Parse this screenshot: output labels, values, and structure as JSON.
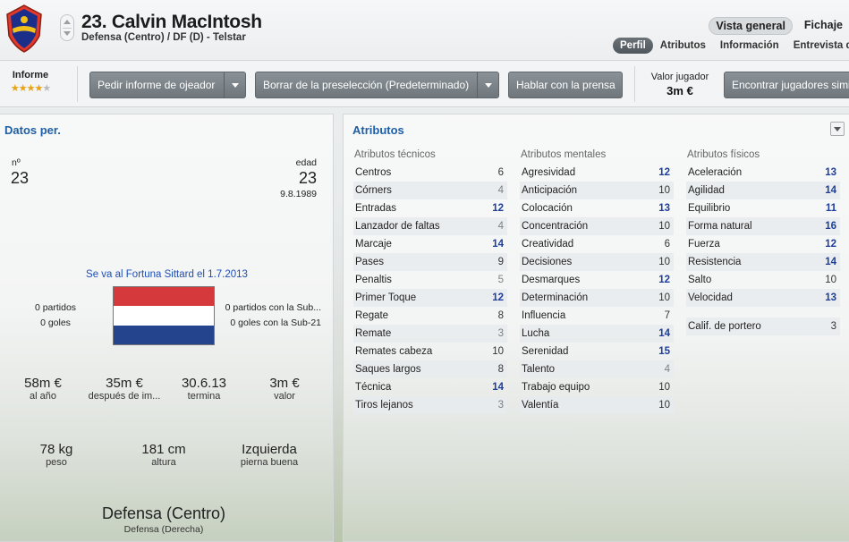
{
  "header": {
    "player_name": "23. Calvin MacIntosh",
    "player_subtitle": "Defensa (Centro) / DF (D) - Telstar",
    "top_tabs": [
      "Vista general",
      "Fichaje"
    ],
    "sub_tabs": [
      "Perfil",
      "Atributos",
      "Información",
      "Entrevista de"
    ]
  },
  "toolbar": {
    "report_label": "Informe",
    "report_stars": 4,
    "report_stars_max": 5,
    "btn_scout": "Pedir informe de ojeador",
    "btn_shortlist": "Borrar de la preselección (Predeterminado)",
    "btn_press": "Hablar con la prensa",
    "value_label": "Valor jugador",
    "value_amount": "3m €",
    "btn_find": "Encontrar jugadores similares"
  },
  "personal": {
    "title": "Datos per.",
    "number_label": "nº",
    "number": "23",
    "age_label": "edad",
    "age": "23",
    "birthdate": "9.8.1989",
    "transfer_note": "Se va al Fortuna Sittard el 1.7.2013",
    "matches": "0 partidos",
    "goals": "0 goles",
    "u21_matches": "0 partidos con la Sub...",
    "u21_goals": "0 goles con la Sub-21",
    "contract": [
      {
        "value": "58m €",
        "label": "al año"
      },
      {
        "value": "35m €",
        "label": "después de im..."
      },
      {
        "value": "30.6.13",
        "label": "termina"
      },
      {
        "value": "3m €",
        "label": "valor"
      }
    ],
    "physical": [
      {
        "value": "78 kg",
        "label": "peso"
      },
      {
        "value": "181 cm",
        "label": "altura"
      },
      {
        "value": "Izquierda",
        "label": "pierna buena"
      }
    ],
    "position_main": "Defensa (Centro)",
    "position_secondary": "Defensa (Derecha)"
  },
  "attributes": {
    "title": "Atributos",
    "technical": {
      "header": "Atributos técnicos",
      "items": [
        {
          "name": "Centros",
          "value": "6",
          "tone": "dark"
        },
        {
          "name": "Córners",
          "value": "4",
          "tone": "gray"
        },
        {
          "name": "Entradas",
          "value": "12",
          "tone": "blue"
        },
        {
          "name": "Lanzador de faltas",
          "value": "4",
          "tone": "gray"
        },
        {
          "name": "Marcaje",
          "value": "14",
          "tone": "blue"
        },
        {
          "name": "Pases",
          "value": "9",
          "tone": "dark"
        },
        {
          "name": "Penaltis",
          "value": "5",
          "tone": "gray"
        },
        {
          "name": "Primer Toque",
          "value": "12",
          "tone": "blue"
        },
        {
          "name": "Regate",
          "value": "8",
          "tone": "dark"
        },
        {
          "name": "Remate",
          "value": "3",
          "tone": "gray"
        },
        {
          "name": "Remates cabeza",
          "value": "10",
          "tone": "dark"
        },
        {
          "name": "Saques largos",
          "value": "8",
          "tone": "dark"
        },
        {
          "name": "Técnica",
          "value": "14",
          "tone": "blue"
        },
        {
          "name": "Tiros lejanos",
          "value": "3",
          "tone": "gray"
        }
      ]
    },
    "mental": {
      "header": "Atributos mentales",
      "items": [
        {
          "name": "Agresividad",
          "value": "12",
          "tone": "blue"
        },
        {
          "name": "Anticipación",
          "value": "10",
          "tone": "dark"
        },
        {
          "name": "Colocación",
          "value": "13",
          "tone": "blue"
        },
        {
          "name": "Concentración",
          "value": "10",
          "tone": "dark"
        },
        {
          "name": "Creatividad",
          "value": "6",
          "tone": "dark"
        },
        {
          "name": "Decisiones",
          "value": "10",
          "tone": "dark"
        },
        {
          "name": "Desmarques",
          "value": "12",
          "tone": "blue"
        },
        {
          "name": "Determinación",
          "value": "10",
          "tone": "dark"
        },
        {
          "name": "Influencia",
          "value": "7",
          "tone": "dark"
        },
        {
          "name": "Lucha",
          "value": "14",
          "tone": "blue"
        },
        {
          "name": "Serenidad",
          "value": "15",
          "tone": "blue"
        },
        {
          "name": "Talento",
          "value": "4",
          "tone": "gray"
        },
        {
          "name": "Trabajo equipo",
          "value": "10",
          "tone": "dark"
        },
        {
          "name": "Valentía",
          "value": "10",
          "tone": "dark"
        }
      ]
    },
    "physical": {
      "header": "Atributos físicos",
      "items": [
        {
          "name": "Aceleración",
          "value": "13",
          "tone": "blue"
        },
        {
          "name": "Agilidad",
          "value": "14",
          "tone": "blue"
        },
        {
          "name": "Equilibrio",
          "value": "11",
          "tone": "blue"
        },
        {
          "name": "Forma natural",
          "value": "16",
          "tone": "blue"
        },
        {
          "name": "Fuerza",
          "value": "12",
          "tone": "blue"
        },
        {
          "name": "Resistencia",
          "value": "14",
          "tone": "blue"
        },
        {
          "name": "Salto",
          "value": "10",
          "tone": "dark"
        },
        {
          "name": "Velocidad",
          "value": "13",
          "tone": "blue"
        }
      ],
      "goalkeeper": {
        "name": "Calif. de portero",
        "value": "3",
        "tone": "dark"
      }
    }
  },
  "colors": {
    "accent_blue": "#1f5fa5",
    "attr_blue": "#1d3e9c",
    "button_gray": "#7a8287",
    "flag_red": "#d6393c",
    "flag_white": "#ffffff",
    "flag_blue": "#24448e",
    "star_gold": "#e7a316"
  }
}
